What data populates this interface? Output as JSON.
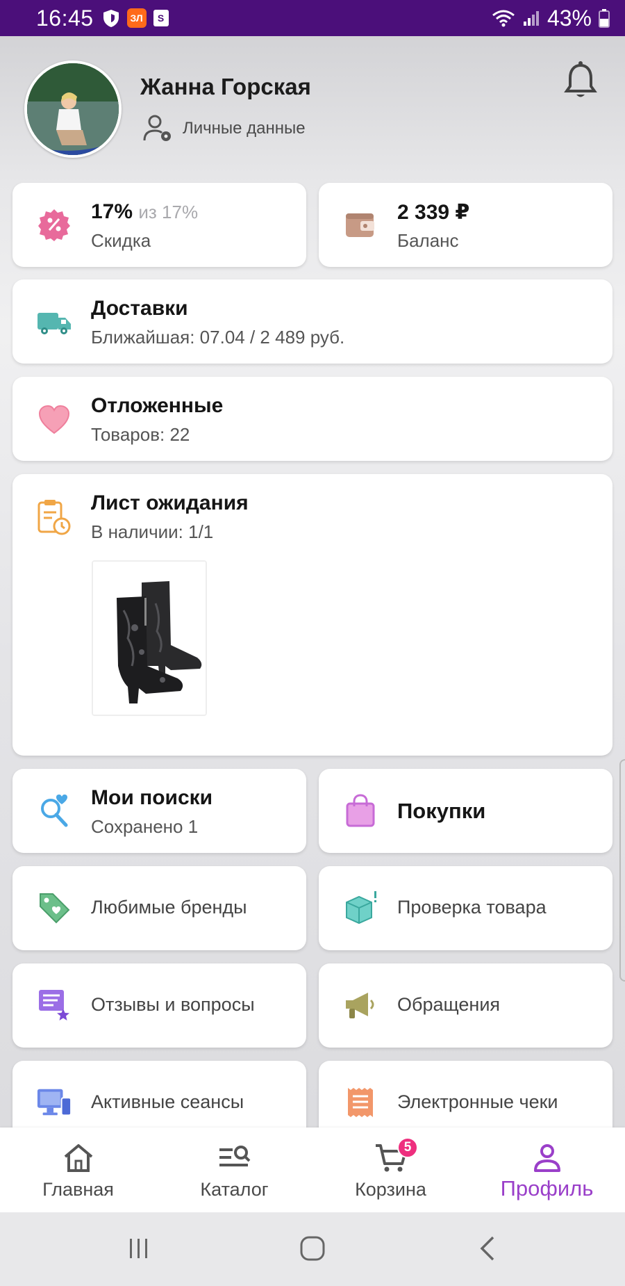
{
  "status_bar": {
    "time": "16:45",
    "battery": "43%",
    "app_badges": [
      "ЗЛ",
      "S"
    ]
  },
  "profile": {
    "name": "Жанна Горская",
    "personal_data_label": "Личные данные"
  },
  "discount": {
    "value": "17%",
    "of_label": "из 17%",
    "label": "Скидка"
  },
  "balance": {
    "value": "2 339 ₽",
    "label": "Баланс"
  },
  "deliveries": {
    "title": "Доставки",
    "subtitle": "Ближайшая: 07.04 / 2 489 руб."
  },
  "favorites": {
    "title": "Отложенные",
    "subtitle": "Товаров: 22"
  },
  "waitlist": {
    "title": "Лист ожидания",
    "subtitle": "В наличии: 1/1"
  },
  "searches": {
    "title": "Мои поиски",
    "subtitle": "Сохранено 1"
  },
  "purchases": {
    "title": "Покупки"
  },
  "menu": {
    "brands": "Любимые бренды",
    "check": "Проверка товара",
    "reviews": "Отзывы и вопросы",
    "appeals": "Обращения",
    "sessions": "Активные сеансы",
    "receipts": "Электронные чеки"
  },
  "tabbar": {
    "home": "Главная",
    "catalog": "Каталог",
    "cart": "Корзина",
    "cart_badge": "5",
    "profile": "Профиль"
  },
  "colors": {
    "status_bar": "#4b0f7a",
    "accent": "#9a3fc9",
    "badge": "#ee2f7e"
  }
}
